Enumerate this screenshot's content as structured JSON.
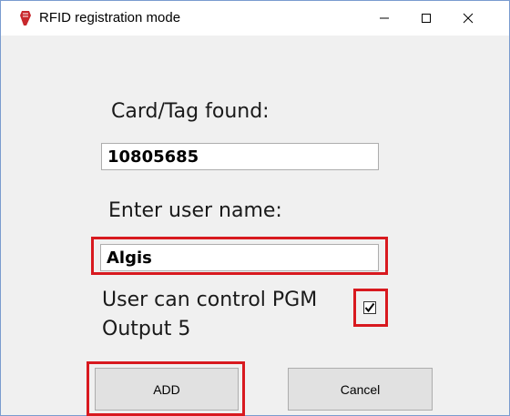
{
  "window": {
    "title": "RFID registration mode",
    "icon": "red-tag-icon",
    "controls": [
      "minimize-icon",
      "maximize-icon",
      "close-icon"
    ]
  },
  "form": {
    "card_label": "Card/Tag found:",
    "card_value": "10805685",
    "user_label": "Enter user name:",
    "user_value": "Algis",
    "pgm_label_line1": "User can control PGM",
    "pgm_label_line2": "Output 5",
    "pgm_checked": true
  },
  "buttons": {
    "add_label": "ADD",
    "cancel_label": "Cancel"
  },
  "colors": {
    "highlight": "#d8191f",
    "window_border": "#7a9ccf",
    "background": "#f0f0f0"
  }
}
